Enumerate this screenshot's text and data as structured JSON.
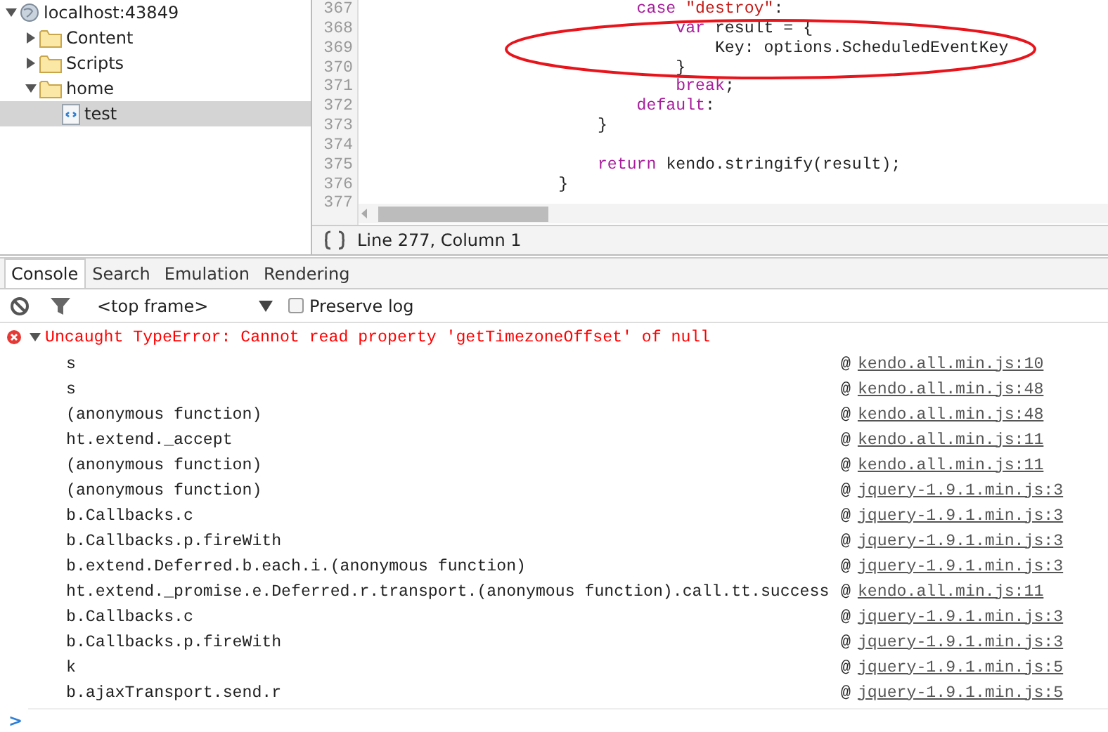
{
  "sources_tree": [
    {
      "label": "localhost:43849",
      "kind": "host",
      "expanded": true,
      "selected": false,
      "children": [
        {
          "label": "Content",
          "kind": "folder",
          "expanded": false,
          "selected": false
        },
        {
          "label": "Scripts",
          "kind": "folder",
          "expanded": false,
          "selected": false
        },
        {
          "label": "home",
          "kind": "folder",
          "expanded": true,
          "selected": false,
          "children": [
            {
              "label": "test",
              "kind": "file",
              "selected": true
            }
          ]
        }
      ]
    }
  ],
  "editor": {
    "lines": [
      {
        "number": "367",
        "tokens": [
          {
            "text": "                            case ",
            "kind": "keyword"
          },
          {
            "text": "\"destroy\"",
            "kind": "string"
          },
          {
            "text": ":",
            "kind": "plain"
          }
        ]
      },
      {
        "number": "368",
        "tokens": [
          {
            "text": "                                var",
            "kind": "keyword"
          },
          {
            "text": " result = {",
            "kind": "plain"
          }
        ]
      },
      {
        "number": "369",
        "tokens": [
          {
            "text": "                                    Key: options.ScheduledEventKey",
            "kind": "plain"
          }
        ]
      },
      {
        "number": "370",
        "tokens": [
          {
            "text": "                                }",
            "kind": "plain"
          }
        ]
      },
      {
        "number": "371",
        "tokens": [
          {
            "text": "                                break",
            "kind": "keyword"
          },
          {
            "text": ";",
            "kind": "plain"
          }
        ]
      },
      {
        "number": "372",
        "tokens": [
          {
            "text": "                            default",
            "kind": "keyword"
          },
          {
            "text": ":",
            "kind": "plain"
          }
        ]
      },
      {
        "number": "373",
        "tokens": [
          {
            "text": "                        }",
            "kind": "plain"
          }
        ]
      },
      {
        "number": "374"
      },
      {
        "number": "375",
        "tokens": [
          {
            "text": "                        return",
            "kind": "keyword"
          },
          {
            "text": " kendo.stringify(result);",
            "kind": "plain"
          }
        ]
      },
      {
        "number": "376",
        "tokens": [
          {
            "text": "                    }",
            "kind": "plain"
          }
        ]
      },
      {
        "number": "377"
      }
    ],
    "annotation": {
      "kind": "ellipse",
      "color": "#e8141c"
    }
  },
  "status_bar": {
    "position": "Line 277, Column 1"
  },
  "drawer_tabs": [
    {
      "label": "Console",
      "selected": true
    },
    {
      "label": "Search",
      "selected": false
    },
    {
      "label": "Emulation",
      "selected": false
    },
    {
      "label": "Rendering",
      "selected": false
    }
  ],
  "console_toolbar": {
    "context": "<top frame>",
    "preserve_log": false,
    "preserve_log_label": "Preserve log"
  },
  "console": {
    "error": {
      "message": "Uncaught TypeError: Cannot read property 'getTimezoneOffset' of null",
      "expanded": true
    },
    "stack": [
      {
        "function": "s",
        "at": "@",
        "location": "kendo.all.min.js:10"
      },
      {
        "function": "s",
        "at": "@",
        "location": "kendo.all.min.js:48"
      },
      {
        "function": "(anonymous function)",
        "at": "@",
        "location": "kendo.all.min.js:48"
      },
      {
        "function": "ht.extend._accept",
        "at": "@",
        "location": "kendo.all.min.js:11"
      },
      {
        "function": "(anonymous function)",
        "at": "@",
        "location": "kendo.all.min.js:11"
      },
      {
        "function": "(anonymous function)",
        "at": "@",
        "location": "jquery-1.9.1.min.js:3"
      },
      {
        "function": "b.Callbacks.c",
        "at": "@",
        "location": "jquery-1.9.1.min.js:3"
      },
      {
        "function": "b.Callbacks.p.fireWith",
        "at": "@",
        "location": "jquery-1.9.1.min.js:3"
      },
      {
        "function": "b.extend.Deferred.b.each.i.(anonymous function)",
        "at": "@",
        "location": "jquery-1.9.1.min.js:3"
      },
      {
        "function": "ht.extend._promise.e.Deferred.r.transport.(anonymous function).call.tt.success",
        "at": "@",
        "location": "kendo.all.min.js:11"
      },
      {
        "function": "b.Callbacks.c",
        "at": "@",
        "location": "jquery-1.9.1.min.js:3"
      },
      {
        "function": "b.Callbacks.p.fireWith",
        "at": "@",
        "location": "jquery-1.9.1.min.js:3"
      },
      {
        "function": "k",
        "at": "@",
        "location": "jquery-1.9.1.min.js:5"
      },
      {
        "function": "b.ajaxTransport.send.r",
        "at": "@",
        "location": "jquery-1.9.1.min.js:5"
      }
    ],
    "prompt": ">"
  }
}
